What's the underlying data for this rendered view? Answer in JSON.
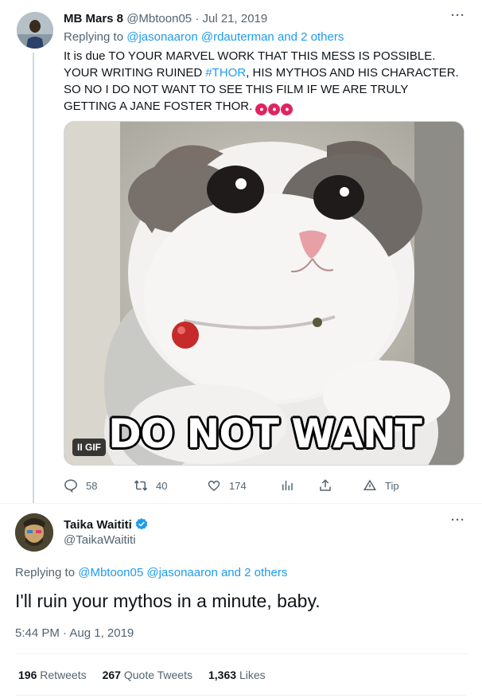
{
  "reply_tweet": {
    "display_name": "MB Mars 8",
    "handle": "@Mbtoon05",
    "separator": "·",
    "date": "Jul 21, 2019",
    "replying_prefix": "Replying to",
    "replying_mentions": [
      "@jasonaaron",
      "@rdauterman"
    ],
    "replying_others": "and 2 others",
    "text_part1": "It is due TO YOUR MARVEL WORK THAT THIS MESS IS POSSIBLE. YOUR WRITING RUINED ",
    "hashtag": "#THOR",
    "text_part2": ", HIS MYTHOS AND HIS CHARACTER. SO NO I DO NOT WANT TO SEE THIS FILM IF WE ARE TRULY GETTING A JANE FOSTER THOR.",
    "emojis": [
      "angry-face",
      "angry-face",
      "angry-face"
    ],
    "media": {
      "caption": "DO NOT WANT",
      "gif_badge": "GIF",
      "pause_glyph": "II"
    },
    "actions": {
      "replies": "58",
      "retweets": "40",
      "likes": "174",
      "tip": "Tip"
    },
    "more_glyph": "···"
  },
  "main_tweet": {
    "display_name": "Taika Waititi",
    "handle": "@TaikaWaititi",
    "verified": true,
    "replying_prefix": "Replying to",
    "replying_mentions": [
      "@Mbtoon05",
      "@jasonaaron"
    ],
    "replying_others": "and 2 others",
    "text": "I'll ruin your mythos in a minute, baby.",
    "timestamp": "5:44 PM · Aug 1, 2019",
    "stats": [
      {
        "count": "196",
        "label": "Retweets"
      },
      {
        "count": "267",
        "label": "Quote Tweets"
      },
      {
        "count": "1,363",
        "label": "Likes"
      }
    ],
    "more_glyph": "···"
  },
  "colors": {
    "accent": "#1d9bf0",
    "text": "#0f1419",
    "muted": "#536471",
    "divider": "#eff3f4",
    "angry_emoji": "#e0245e"
  }
}
